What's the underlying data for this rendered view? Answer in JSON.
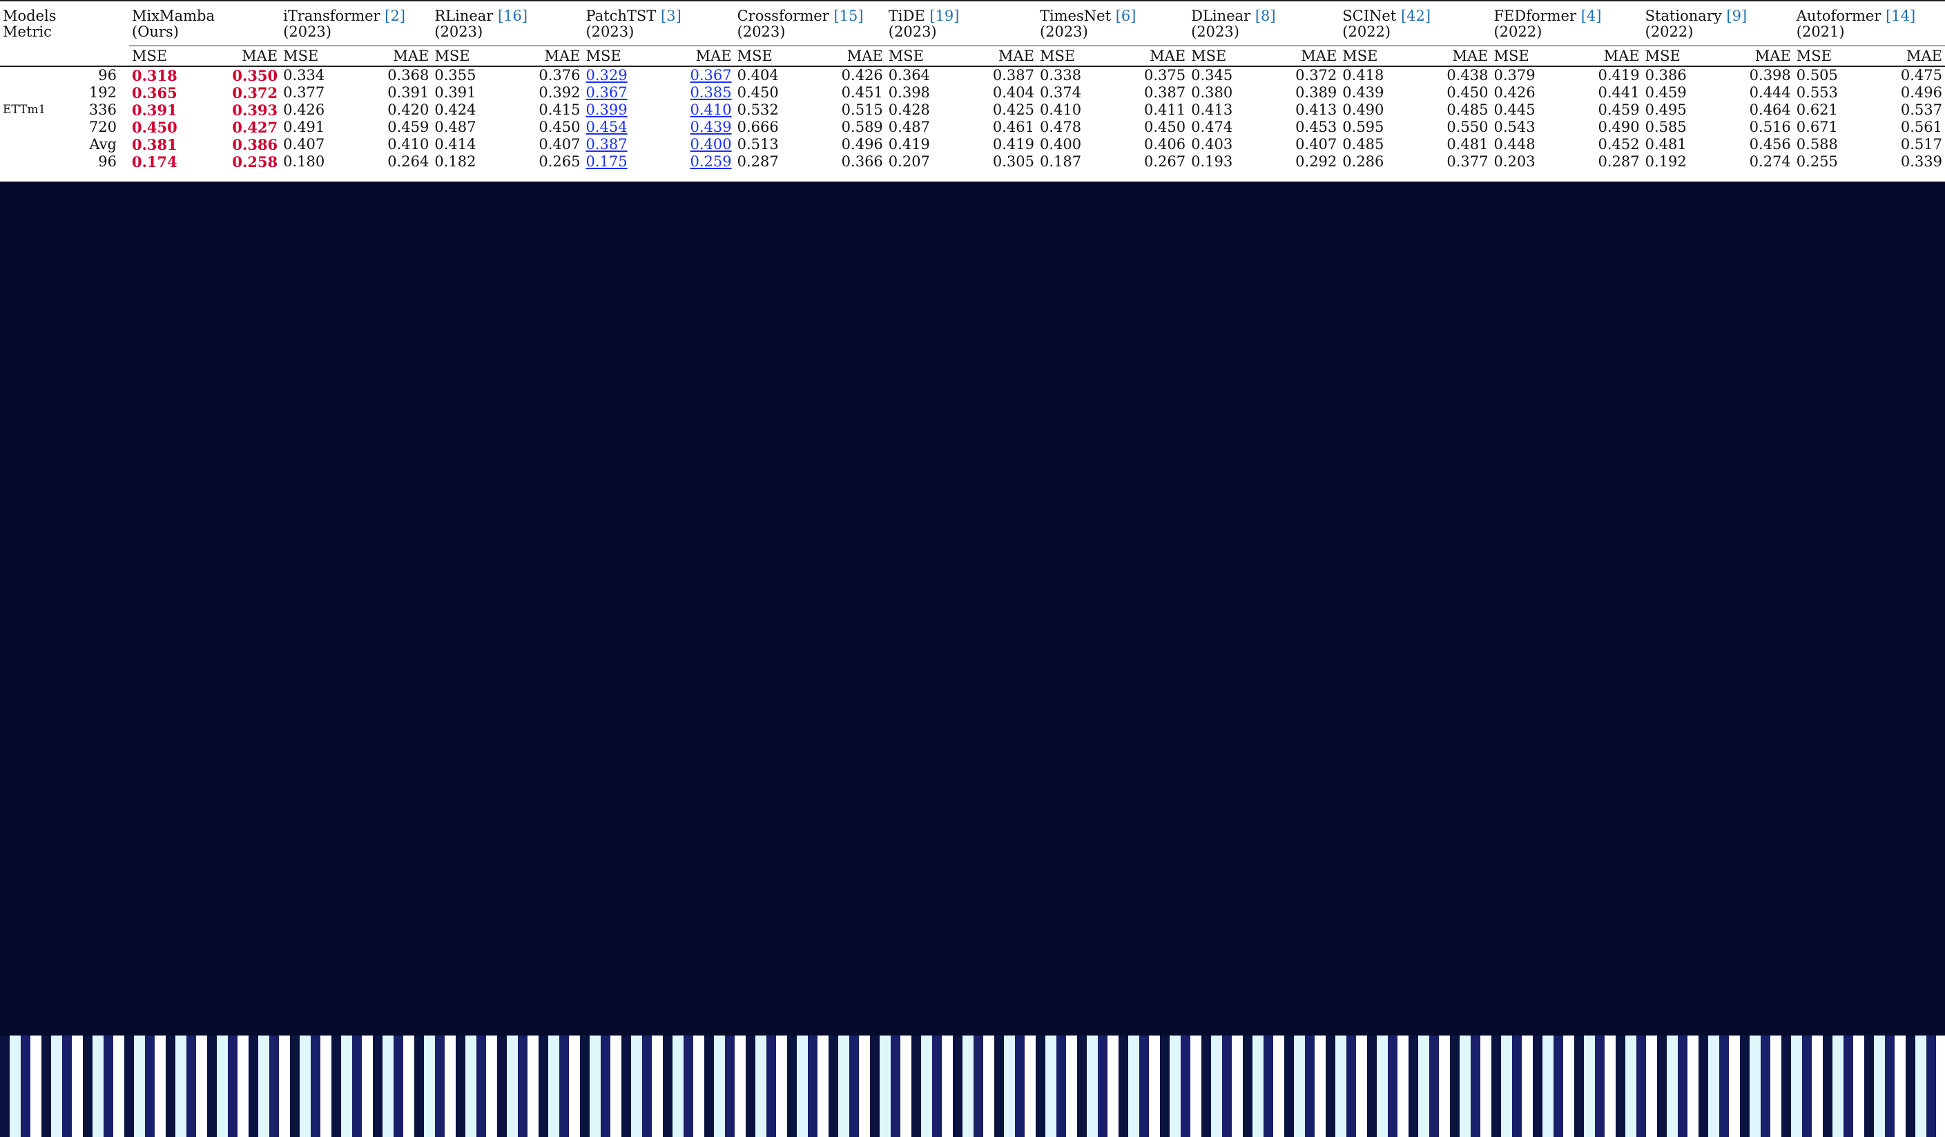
{
  "header": {
    "metric_label_1": "Models",
    "metric_label_2": "Metric",
    "metric_mse": "MSE",
    "metric_mae": "MAE",
    "models": [
      {
        "name": "MixMamba",
        "year": "(Ours)",
        "ref": ""
      },
      {
        "name": "iTransformer",
        "year": "(2023)",
        "ref": "[2]"
      },
      {
        "name": "RLinear",
        "year": "(2023)",
        "ref": "[16]"
      },
      {
        "name": "PatchTST",
        "year": "(2023)",
        "ref": "[3]"
      },
      {
        "name": "Crossformer",
        "year": "(2023)",
        "ref": "[15]"
      },
      {
        "name": "TiDE",
        "year": "(2023)",
        "ref": "[19]"
      },
      {
        "name": "TimesNet",
        "year": "(2023)",
        "ref": "[6]"
      },
      {
        "name": "DLinear",
        "year": "(2023)",
        "ref": "[8]"
      },
      {
        "name": "SCINet",
        "year": "(2022)",
        "ref": "[42]"
      },
      {
        "name": "FEDformer",
        "year": "(2022)",
        "ref": "[4]"
      },
      {
        "name": "Stationary",
        "year": "(2022)",
        "ref": "[9]"
      },
      {
        "name": "Autoformer",
        "year": "(2021)",
        "ref": "[14]"
      }
    ]
  },
  "rows": [
    {
      "dataset": "",
      "horizon": "96",
      "cells": [
        "0.318",
        "0.350",
        "0.334",
        "0.368",
        "0.355",
        "0.376",
        "0.329",
        "0.367",
        "0.404",
        "0.426",
        "0.364",
        "0.387",
        "0.338",
        "0.375",
        "0.345",
        "0.372",
        "0.418",
        "0.438",
        "0.379",
        "0.419",
        "0.386",
        "0.398",
        "0.505",
        "0.475"
      ],
      "marks": [
        "best",
        "best",
        "",
        "",
        "",
        "",
        "second",
        "second",
        "",
        "",
        "",
        "",
        "",
        "",
        "",
        "",
        "",
        "",
        "",
        "",
        "",
        "",
        "",
        ""
      ]
    },
    {
      "dataset": "",
      "horizon": "192",
      "cells": [
        "0.365",
        "0.372",
        "0.377",
        "0.391",
        "0.391",
        "0.392",
        "0.367",
        "0.385",
        "0.450",
        "0.451",
        "0.398",
        "0.404",
        "0.374",
        "0.387",
        "0.380",
        "0.389",
        "0.439",
        "0.450",
        "0.426",
        "0.441",
        "0.459",
        "0.444",
        "0.553",
        "0.496"
      ],
      "marks": [
        "best",
        "best",
        "",
        "",
        "",
        "",
        "second",
        "second",
        "",
        "",
        "",
        "",
        "",
        "",
        "",
        "",
        "",
        "",
        "",
        "",
        "",
        "",
        "",
        ""
      ]
    },
    {
      "dataset": "ETTm1",
      "horizon": "336",
      "cells": [
        "0.391",
        "0.393",
        "0.426",
        "0.420",
        "0.424",
        "0.415",
        "0.399",
        "0.410",
        "0.532",
        "0.515",
        "0.428",
        "0.425",
        "0.410",
        "0.411",
        "0.413",
        "0.413",
        "0.490",
        "0.485",
        "0.445",
        "0.459",
        "0.495",
        "0.464",
        "0.621",
        "0.537"
      ],
      "marks": [
        "best",
        "best",
        "",
        "",
        "",
        "",
        "second",
        "second",
        "",
        "",
        "",
        "",
        "",
        "",
        "",
        "",
        "",
        "",
        "",
        "",
        "",
        "",
        "",
        ""
      ]
    },
    {
      "dataset": "",
      "horizon": "720",
      "cells": [
        "0.450",
        "0.427",
        "0.491",
        "0.459",
        "0.487",
        "0.450",
        "0.454",
        "0.439",
        "0.666",
        "0.589",
        "0.487",
        "0.461",
        "0.478",
        "0.450",
        "0.474",
        "0.453",
        "0.595",
        "0.550",
        "0.543",
        "0.490",
        "0.585",
        "0.516",
        "0.671",
        "0.561"
      ],
      "marks": [
        "best",
        "best",
        "",
        "",
        "",
        "",
        "second",
        "second",
        "",
        "",
        "",
        "",
        "",
        "",
        "",
        "",
        "",
        "",
        "",
        "",
        "",
        "",
        "",
        ""
      ]
    },
    {
      "dataset": "",
      "horizon": "Avg",
      "cells": [
        "0.381",
        "0.386",
        "0.407",
        "0.410",
        "0.414",
        "0.407",
        "0.387",
        "0.400",
        "0.513",
        "0.496",
        "0.419",
        "0.419",
        "0.400",
        "0.406",
        "0.403",
        "0.407",
        "0.485",
        "0.481",
        "0.448",
        "0.452",
        "0.481",
        "0.456",
        "0.588",
        "0.517"
      ],
      "marks": [
        "best",
        "best",
        "",
        "",
        "",
        "",
        "second",
        "second",
        "",
        "",
        "",
        "",
        "",
        "",
        "",
        "",
        "",
        "",
        "",
        "",
        "",
        "",
        "",
        ""
      ]
    },
    {
      "dataset": "",
      "horizon": "96",
      "cells": [
        "0.174",
        "0.258",
        "0.180",
        "0.264",
        "0.182",
        "0.265",
        "0.175",
        "0.259",
        "0.287",
        "0.366",
        "0.207",
        "0.305",
        "0.187",
        "0.267",
        "0.193",
        "0.292",
        "0.286",
        "0.377",
        "0.203",
        "0.287",
        "0.192",
        "0.274",
        "0.255",
        "0.339"
      ],
      "marks": [
        "best",
        "best",
        "",
        "",
        "",
        "",
        "second",
        "second",
        "",
        "",
        "",
        "",
        "",
        "",
        "",
        "",
        "",
        "",
        "",
        "",
        "",
        "",
        "",
        ""
      ]
    }
  ],
  "colors": {
    "best": "#d0002e",
    "second": "#1a2fff",
    "ref": "#1f6fb2",
    "band": "#060b2c"
  }
}
